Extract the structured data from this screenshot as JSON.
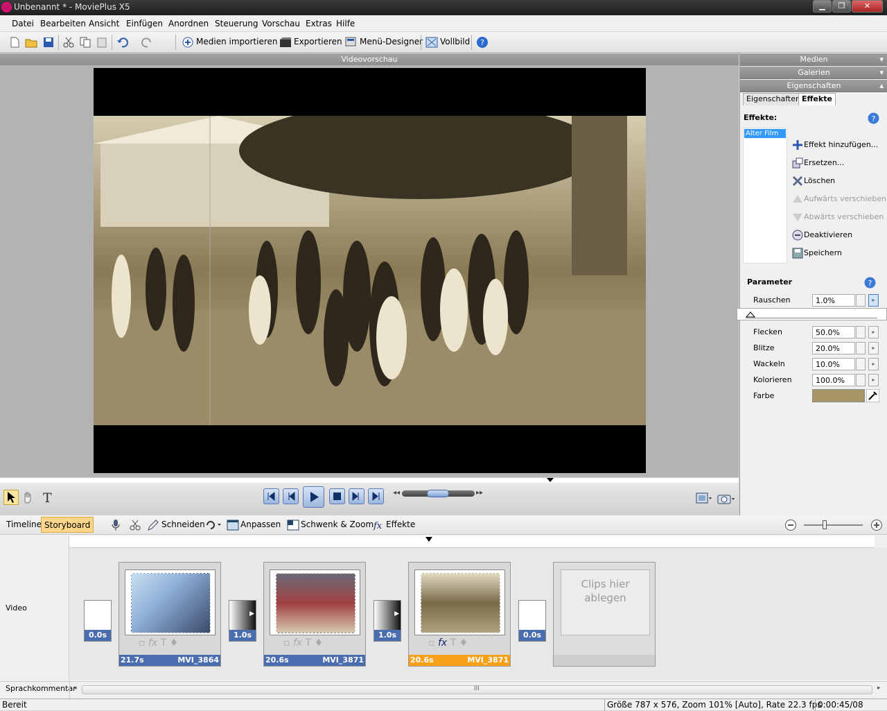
{
  "window": {
    "title": "Unbenannt * - MoviePlus X5",
    "minimize": "▁",
    "restore": "❐",
    "close": "✕"
  },
  "menu": [
    "Datei",
    "Bearbeiten",
    "Ansicht",
    "Einfügen",
    "Anordnen",
    "Steuerung",
    "Vorschau",
    "Extras",
    "Hilfe"
  ],
  "toolbar": {
    "import": "Medien importieren",
    "export": "Exportieren",
    "menu_designer": "Menü-Designer",
    "fullscreen": "Vollbild"
  },
  "preview": {
    "header": "Videovorschau"
  },
  "right_pane": {
    "sections": [
      "Medien",
      "Galerien",
      "Eigenschaften"
    ],
    "tabs": {
      "properties": "Eigenschaften",
      "effects": "Effekte"
    },
    "effects_label": "Effekte:",
    "effects_list": [
      "Alter Film"
    ],
    "actions": {
      "add": "Effekt hinzufügen...",
      "replace": "Ersetzen...",
      "delete": "Löschen",
      "up": "Aufwärts verschieben",
      "down": "Abwärts verschieben",
      "deactivate": "Deaktivieren",
      "save": "Speichern"
    },
    "parameters_label": "Parameter",
    "parameters": [
      {
        "name": "Rauschen",
        "value": "1.0%"
      },
      {
        "name": "Flecken",
        "value": "50.0%"
      },
      {
        "name": "Blitze",
        "value": "20.0%"
      },
      {
        "name": "Wackeln",
        "value": "10.0%"
      },
      {
        "name": "Kolorieren",
        "value": "100.0%"
      }
    ],
    "color_label": "Farbe",
    "color_value": "#a89664"
  },
  "bottom": {
    "tabs": {
      "timeline": "Timeline",
      "storyboard": "Storyboard"
    },
    "tools": {
      "cut": "Schneiden",
      "fit": "Anpassen",
      "pan_zoom": "Schwenk & Zoom",
      "effects": "Effekte"
    },
    "track_labels": {
      "video": "Video",
      "voice": "Sprachkommentar"
    },
    "clips": [
      {
        "duration": "21.7s",
        "name": "MVI_3864"
      },
      {
        "duration": "20.6s",
        "name": "MVI_3871"
      },
      {
        "duration": "20.6s",
        "name": "MVI_3871"
      }
    ],
    "transitions": [
      "0.0s",
      "1.0s",
      "1.0s",
      "0.0s"
    ],
    "drop_zone": "Clips hier ablegen",
    "scroll_grip": "III"
  },
  "status": {
    "left": "Bereit",
    "info": "Größe 787 x 576, Zoom 101% [Auto], Rate 22.3 fps",
    "time": "0:00:45/08"
  }
}
